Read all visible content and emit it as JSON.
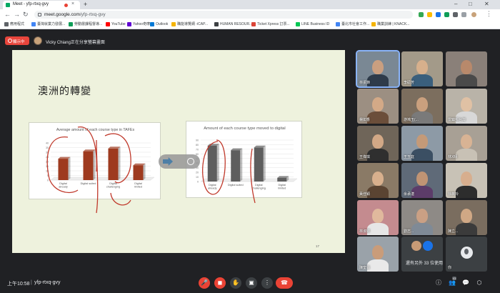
{
  "browser": {
    "tab_title": "Meet - yfp-rtxq-gvy",
    "tab_close": "×",
    "new_tab": "+",
    "url_host": "meet.google.com",
    "url_path": "/yfp-rtxq-gvy",
    "bookmarks": [
      {
        "label": "應用程式",
        "color": "#5f6368"
      },
      {
        "label": "臺灣就業力發展...",
        "color": "#4285f4"
      },
      {
        "label": "勞動層課程督導...",
        "color": "#0f9d58"
      },
      {
        "label": "YouTube",
        "color": "#ff0000"
      },
      {
        "label": "Yahoo奇摩",
        "color": "#6001d2"
      },
      {
        "label": "Outlook",
        "color": "#0078d4"
      },
      {
        "label": "職能導覽網 -iCAP...",
        "color": "#f4b400"
      },
      {
        "label": "HUMAN RESOUR...",
        "color": "#3c4043"
      },
      {
        "label": "Ticket Xpress 訂票...",
        "color": "#db4437"
      },
      {
        "label": "LINE Business ID",
        "color": "#06c755"
      },
      {
        "label": "臺北市社會工作...",
        "color": "#4285f4"
      },
      {
        "label": "職業訓練 | KNACK...",
        "color": "#f4b400"
      }
    ]
  },
  "meet": {
    "present_label": "顯示中",
    "presenter_label": "Vicky Chiang正在分享螢幕畫面",
    "time": "上午10:58",
    "separator": "|",
    "meeting_code": "yfp-rtxq-gvy",
    "participant_count": "41",
    "others_label": "還有另外 33 位使用者",
    "you_label": "你",
    "participants": [
      {
        "name": "林振鋒",
        "bg": "#7a8894",
        "skin": "#c99f80",
        "shirt": "#2e3b4a",
        "active": true
      },
      {
        "name": "李碩芳",
        "bg": "#a39a89",
        "skin": "#d7b08c",
        "shirt": "#3a5f7c",
        "active": false
      },
      {
        "name": "",
        "bg": "#8a8079",
        "skin": "#b8896b",
        "shirt": "#4a4a4a",
        "active": false
      },
      {
        "name": "楊如香",
        "bg": "#9c8f82",
        "skin": "#d3a987",
        "shirt": "#6b4e3a",
        "active": false
      },
      {
        "name": "游鴻玉(...",
        "bg": "#7c6e5e",
        "skin": "#caa07e",
        "shirt": "#7a7a7a",
        "active": false
      },
      {
        "name": "雷鎮邦台灣",
        "bg": "#b9b3a8",
        "skin": "#e0c1a4",
        "shirt": "#d8d8d8",
        "active": false
      },
      {
        "name": "王偉琪",
        "bg": "#6f6559",
        "skin": "#d2a886",
        "shirt": "#2f2f2f",
        "active": false
      },
      {
        "name": "王玉庭",
        "bg": "#8d9aa6",
        "skin": "#c49a78",
        "shirt": "#3b4f63",
        "active": false
      },
      {
        "name": "林X晴",
        "bg": "#a8a095",
        "skin": "#d8b394",
        "shirt": "#c8c1b5",
        "active": false
      },
      {
        "name": "黃佳穎",
        "bg": "#8a7a66",
        "skin": "#d8b08d",
        "shirt": "#5a4432",
        "active": false
      },
      {
        "name": "余承湛",
        "bg": "#5f6a78",
        "skin": "#c09474",
        "shirt": "#5c3c69",
        "active": false
      },
      {
        "name": "徐薇玲",
        "bg": "#c8c2b6",
        "skin": "#d7ae8e",
        "shirt": "#2d2d2d",
        "active": false
      },
      {
        "name": "林淑卿",
        "bg": "#c48b8f",
        "skin": "#e0b99d",
        "shirt": "#e6e6e6",
        "active": false
      },
      {
        "name": "劉志...",
        "bg": "#8e8a86",
        "skin": "#caa084",
        "shirt": "#7f8a96",
        "active": false
      },
      {
        "name": "陳立...",
        "bg": "#7a6d5f",
        "skin": "#d0a885",
        "shirt": "#3b3b3b",
        "active": false
      },
      {
        "name": "陳奎霖",
        "bg": "#9aa2a9",
        "skin": "#c99c7a",
        "shirt": "#e9e9e9",
        "active": false
      }
    ]
  },
  "slide": {
    "title": "澳洲的轉變",
    "page_number": "17"
  },
  "chart_data": [
    {
      "type": "bar",
      "title": "Average amount of each course type in TAFEs",
      "categories": [
        "Digital already",
        "Digital suited",
        "Digital challenging",
        "Digital limited"
      ],
      "values": [
        23,
        31,
        34,
        16
      ],
      "ylim": [
        0,
        40
      ],
      "yticks": [
        0,
        5,
        10,
        15,
        20,
        25,
        30,
        35,
        40
      ],
      "color": "#9e3a1f"
    },
    {
      "type": "bar",
      "title": "Amount of each course type moved to digital",
      "categories": [
        "Digital already",
        "Digital suited",
        "Digital challenging",
        "Digital limited"
      ],
      "values": [
        78,
        68,
        74,
        8
      ],
      "ylim": [
        0,
        90
      ],
      "yticks": [
        0,
        10,
        20,
        30,
        40,
        50,
        60,
        70,
        80,
        90
      ],
      "color": "#5e5e5e"
    }
  ],
  "controls": {
    "mic": "🎤",
    "cam": "◼",
    "hand": "✋",
    "present": "▣",
    "more": "⋮",
    "end": "☎",
    "info": "ⓘ",
    "people": "👥",
    "chat": "💬",
    "activities": "⬡"
  }
}
